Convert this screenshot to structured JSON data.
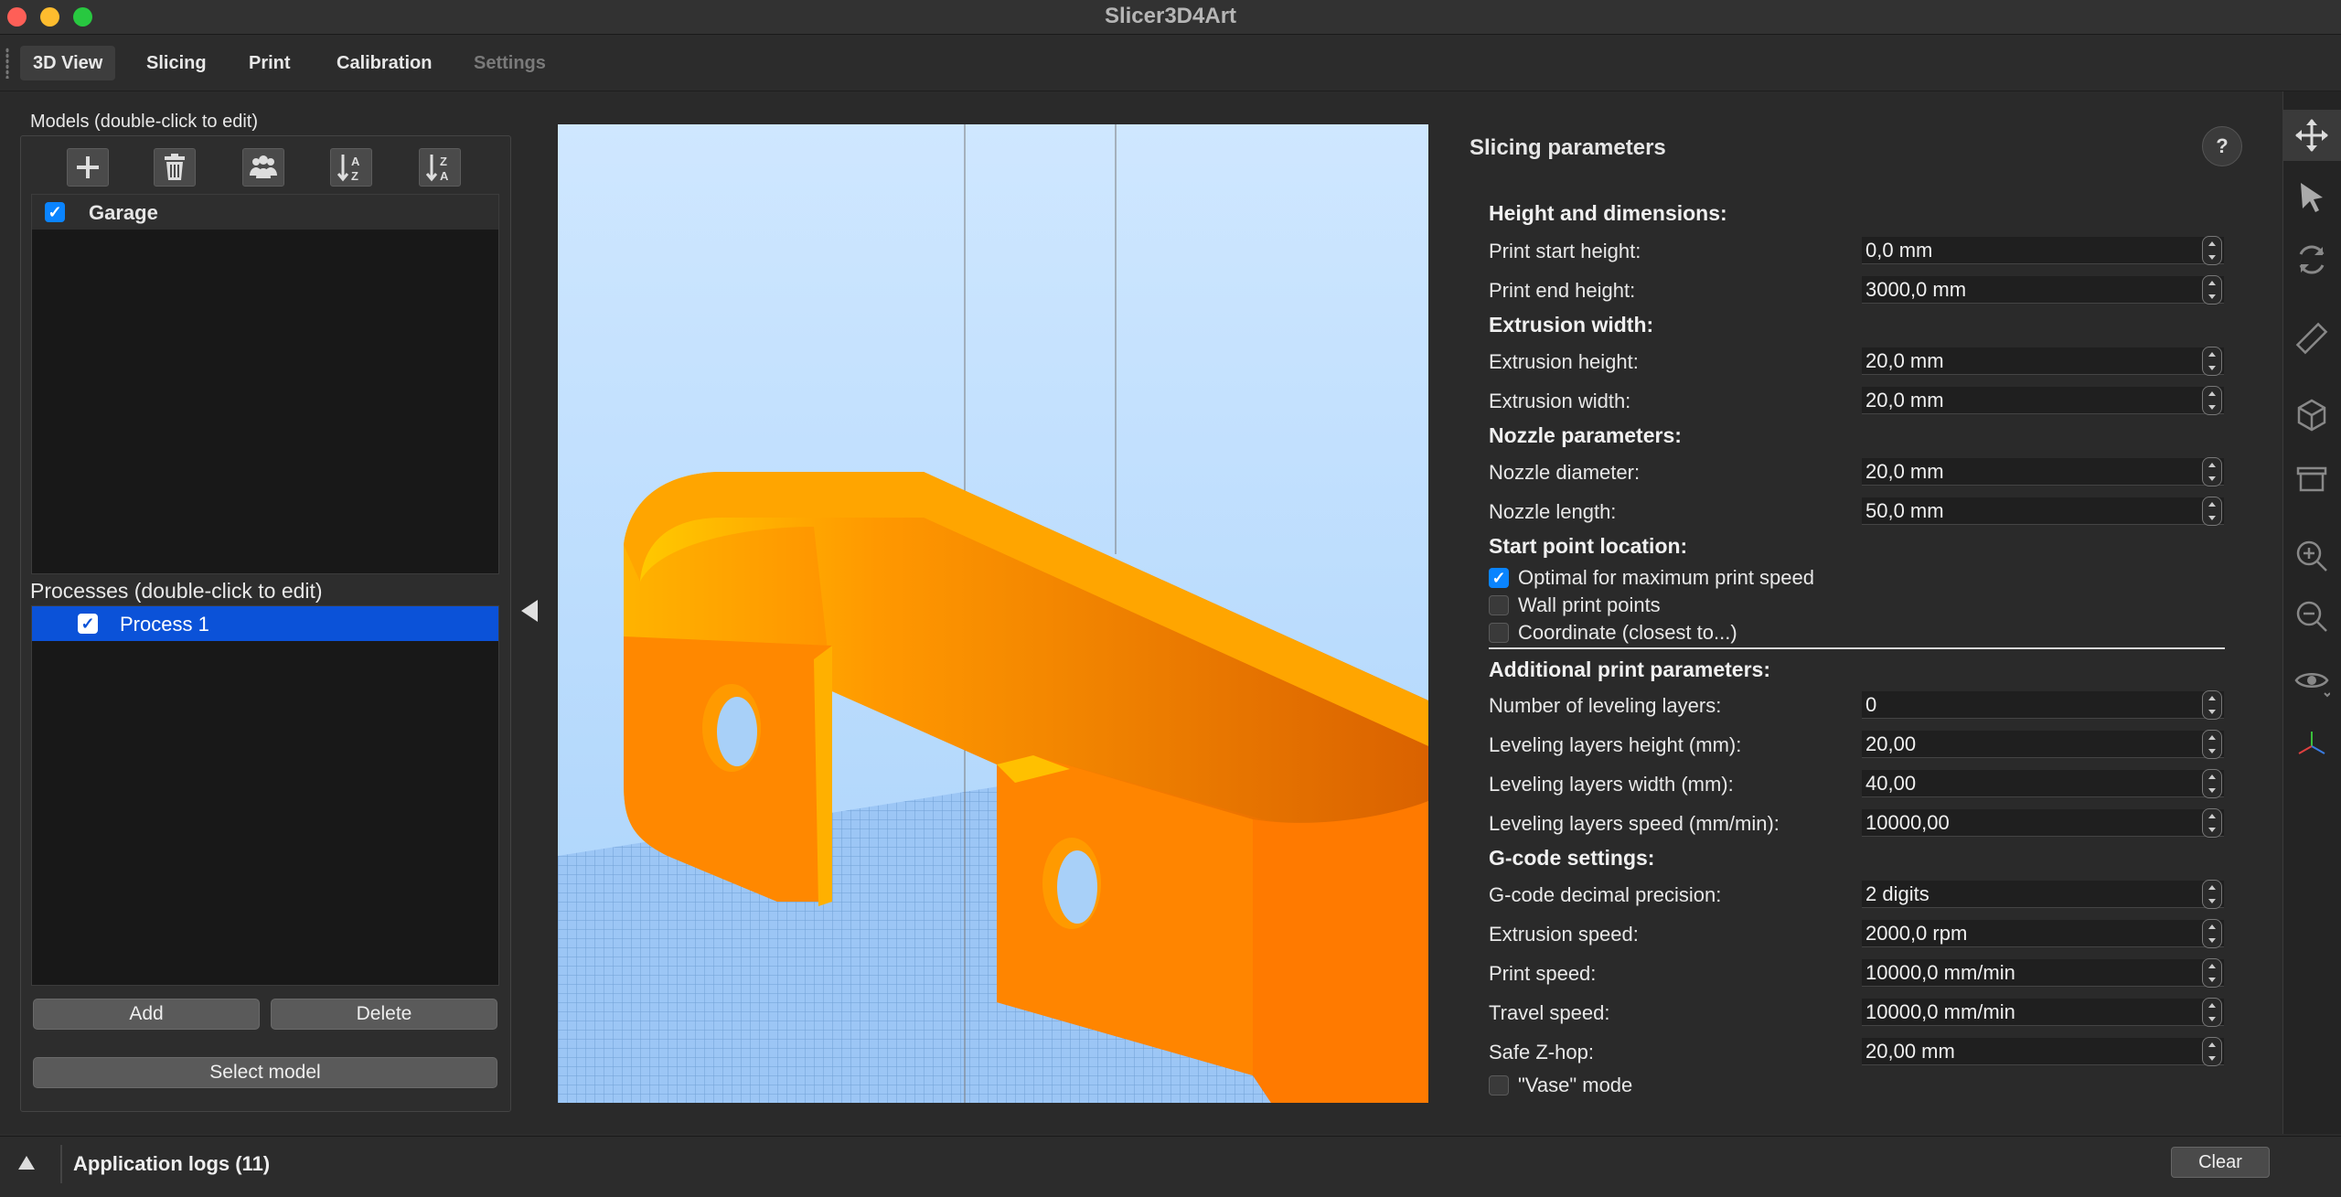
{
  "window": {
    "title": "Slicer3D4Art"
  },
  "tabs": [
    {
      "label": "3D View",
      "active": true
    },
    {
      "label": "Slicing"
    },
    {
      "label": "Print"
    },
    {
      "label": "Calibration"
    },
    {
      "label": "Settings",
      "disabled": true
    }
  ],
  "models": {
    "title": "Models (double-click to edit)",
    "toolbar": [
      "add-icon",
      "trash-icon",
      "group-icon",
      "sort-az-icon",
      "sort-za-icon"
    ],
    "items": [
      {
        "label": "Garage",
        "checked": true
      }
    ]
  },
  "processes": {
    "title": "Processes (double-click to edit)",
    "items": [
      {
        "label": "Process 1",
        "checked": true,
        "selected": true
      }
    ],
    "add_label": "Add",
    "delete_label": "Delete",
    "select_model_label": "Select model"
  },
  "slicing": {
    "title": "Slicing parameters",
    "help_label": "?",
    "sections": {
      "height": "Height and dimensions:",
      "extrusion": "Extrusion width:",
      "nozzle": "Nozzle parameters:",
      "start_point": "Start point location:",
      "additional": "Additional print parameters:",
      "gcode": "G-code settings:"
    },
    "params": {
      "print_start_height": {
        "label": "Print start height:",
        "value": "0,0 mm"
      },
      "print_end_height": {
        "label": "Print end height:",
        "value": "3000,0 mm"
      },
      "extrusion_height": {
        "label": "Extrusion height:",
        "value": "20,0 mm"
      },
      "extrusion_width": {
        "label": "Extrusion width:",
        "value": "20,0 mm"
      },
      "nozzle_diameter": {
        "label": "Nozzle diameter:",
        "value": "20,0 mm"
      },
      "nozzle_length": {
        "label": "Nozzle length:",
        "value": "50,0 mm"
      },
      "leveling_layers": {
        "label": "Number of leveling layers:",
        "value": "0"
      },
      "leveling_height": {
        "label": "Leveling layers height (mm):",
        "value": "20,00"
      },
      "leveling_width": {
        "label": "Leveling layers width (mm):",
        "value": "40,00"
      },
      "leveling_speed": {
        "label": "Leveling layers speed (mm/min):",
        "value": "10000,00"
      },
      "gcode_precision": {
        "label": "G-code decimal precision:",
        "value": "2 digits"
      },
      "extrusion_speed": {
        "label": "Extrusion speed:",
        "value": "2000,0 rpm"
      },
      "print_speed": {
        "label": "Print speed:",
        "value": "10000,0 mm/min"
      },
      "travel_speed": {
        "label": "Travel speed:",
        "value": "10000,0 mm/min"
      },
      "safe_zhop": {
        "label": "Safe Z-hop:",
        "value": "20,00 mm"
      }
    },
    "start_options": {
      "optimal": {
        "label": "Optimal for maximum print speed",
        "checked": true
      },
      "wall": {
        "label": "Wall print points",
        "checked": false
      },
      "coordinate": {
        "label": "Coordinate (closest to...)",
        "checked": false
      }
    },
    "vase_mode": {
      "label": "\"Vase\" mode",
      "checked": false
    }
  },
  "right_toolbar": [
    "move-icon",
    "select-cursor-icon",
    "rotate-icon",
    "ruler-icon",
    "cube-icon",
    "box-icon",
    "zoom-in-icon",
    "zoom-out-icon",
    "eye-icon",
    "axes-icon"
  ],
  "logs": {
    "title": "Application logs (11)",
    "clear_label": "Clear"
  },
  "colors": {
    "accent": "#0a84ff",
    "selection": "#0b52d8",
    "model": "#ff8c00",
    "bed": "#7fb3ee"
  }
}
